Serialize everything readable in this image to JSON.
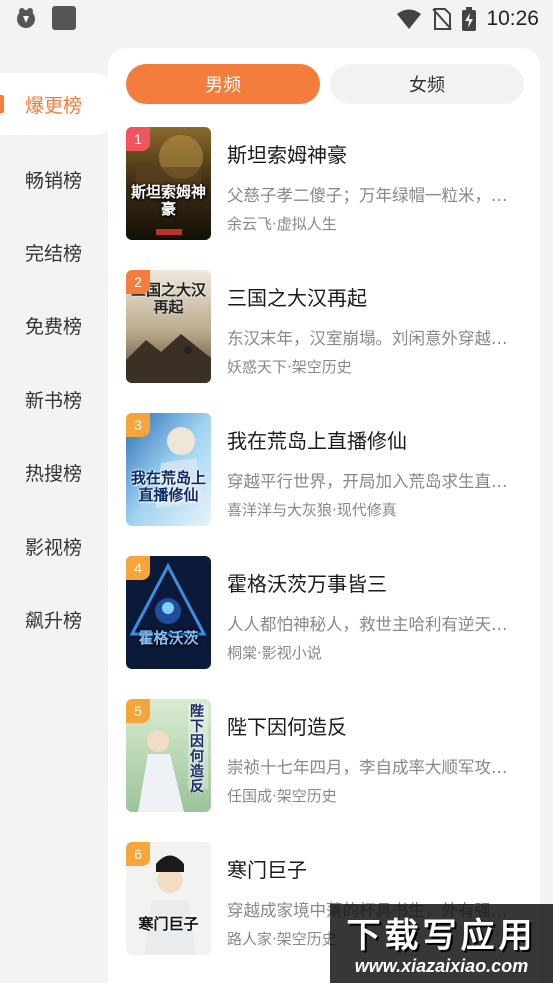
{
  "status_bar": {
    "time": "10:26",
    "icons": [
      "app-notification-icon",
      "app-square-icon",
      "wifi-icon",
      "no-sim-icon",
      "battery-charging-icon"
    ]
  },
  "sidebar": {
    "items": [
      {
        "label": "爆更榜",
        "active": true
      },
      {
        "label": "畅销榜",
        "active": false
      },
      {
        "label": "完结榜",
        "active": false
      },
      {
        "label": "免费榜",
        "active": false
      },
      {
        "label": "新书榜",
        "active": false
      },
      {
        "label": "热搜榜",
        "active": false
      },
      {
        "label": "影视榜",
        "active": false
      },
      {
        "label": "飙升榜",
        "active": false
      }
    ]
  },
  "tabs": {
    "male": "男频",
    "female": "女频",
    "selected": "男频"
  },
  "colors": {
    "accent": "#f47c3c",
    "rank_1": "#f0555f",
    "rank_2": "#f47c3c",
    "rank_other": "#f5a53a"
  },
  "books": [
    {
      "rank": "1",
      "title": "斯坦索姆神豪",
      "desc": "父慈子孝二傻子；万年绿帽一粒米，一生…",
      "author": "余云飞",
      "category": "虚拟人生",
      "cover_text": "斯坦索姆神豪"
    },
    {
      "rank": "2",
      "title": "三国之大汉再起",
      "desc": "东汉末年，汉室崩塌。刘闲意外穿越到…",
      "author": "妖惑天下",
      "category": "架空历史",
      "cover_text": "三国之大汉再起"
    },
    {
      "rank": "3",
      "title": "我在荒岛上直播修仙",
      "desc": "穿越平行世界，开局加入荒岛求生直播…",
      "author": "喜洋洋与大灰狼",
      "category": "现代修真",
      "cover_text": "我在荒岛上直播修仙"
    },
    {
      "rank": "4",
      "title": "霍格沃茨万事皆三",
      "desc": "人人都怕神秘人，救世主哈利有逆天的…",
      "author": "桐棠",
      "category": "影视小说",
      "cover_text": "霍格沃茨"
    },
    {
      "rank": "5",
      "title": "陛下因何造反",
      "desc": "崇祯十七年四月，李自成率大顺军攻入…",
      "author": "任国成",
      "category": "架空历史",
      "cover_text": "陛下因何造反"
    },
    {
      "rank": "6",
      "title": "寒门巨子",
      "desc": "穿越成家境中落的杯具书生，外有强敌…",
      "author": "路人家",
      "category": "架空历史",
      "cover_text": "寒门巨子"
    }
  ],
  "meta_separator": "·",
  "watermark": {
    "main": "下载写应用",
    "sub": "www.xiazaixiao.com"
  }
}
